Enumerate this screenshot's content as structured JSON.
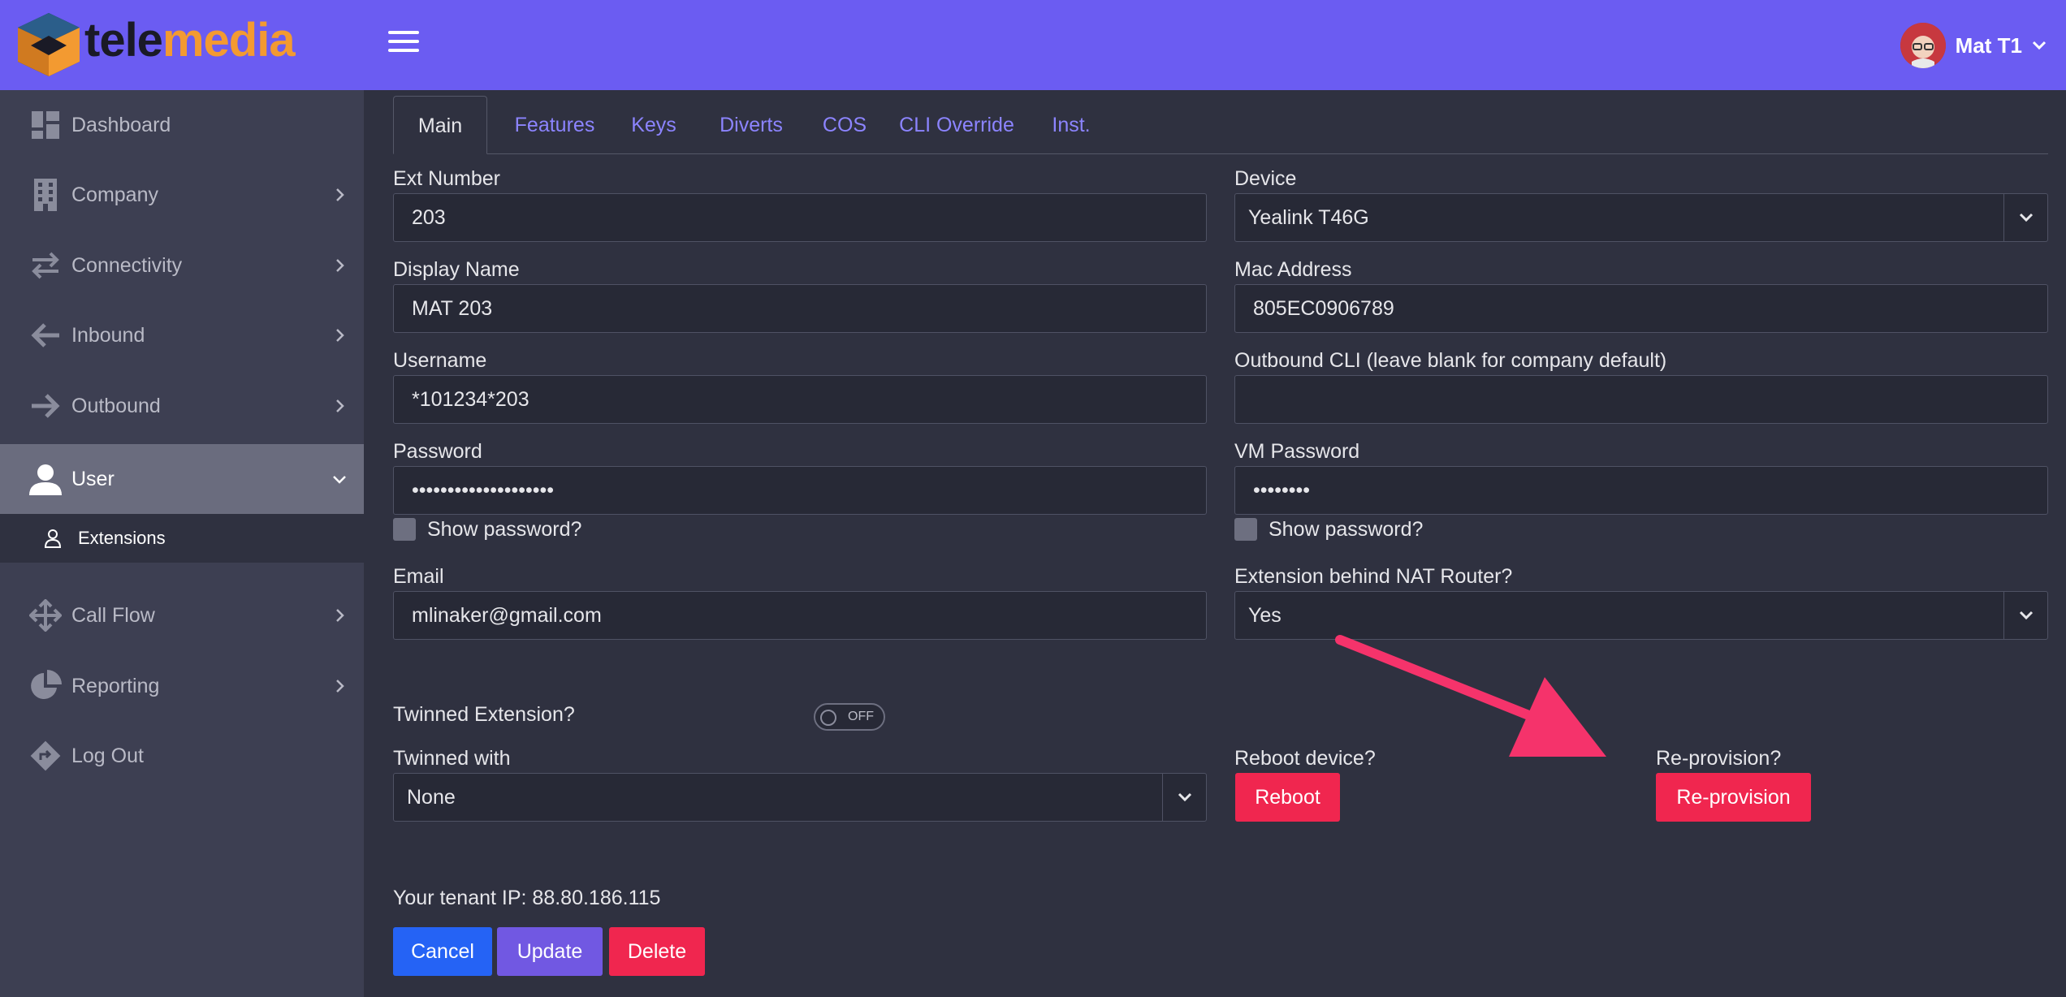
{
  "header": {
    "brand_part1": "tele",
    "brand_part2": "media",
    "user_name": "Mat T1"
  },
  "sidebar": {
    "items": [
      {
        "label": "Dashboard"
      },
      {
        "label": "Company"
      },
      {
        "label": "Connectivity"
      },
      {
        "label": "Inbound"
      },
      {
        "label": "Outbound"
      },
      {
        "label": "User"
      },
      {
        "label": "Call Flow"
      },
      {
        "label": "Reporting"
      },
      {
        "label": "Log Out"
      }
    ],
    "sub_item": "Extensions"
  },
  "tabs": [
    {
      "label": "Main"
    },
    {
      "label": "Features"
    },
    {
      "label": "Keys"
    },
    {
      "label": "Diverts"
    },
    {
      "label": "COS"
    },
    {
      "label": "CLI Override"
    },
    {
      "label": "Inst."
    }
  ],
  "form": {
    "ext_number_label": "Ext Number",
    "ext_number_value": "203",
    "display_name_label": "Display Name",
    "display_name_value": "MAT 203",
    "username_label": "Username",
    "username_value": "*101234*203",
    "password_label": "Password",
    "password_value": "••••••••••••••••••••",
    "show_password_label": "Show password?",
    "email_label": "Email",
    "email_value": "mlinaker@gmail.com",
    "device_label": "Device",
    "device_value": "Yealink T46G",
    "mac_label": "Mac Address",
    "mac_value": "805EC0906789",
    "outbound_cli_label": "Outbound CLI (leave blank for company default)",
    "outbound_cli_value": "",
    "vm_password_label": "VM Password",
    "vm_password_value": "••••••••",
    "vm_show_password_label": "Show password?",
    "nat_label": "Extension behind NAT Router?",
    "nat_value": "Yes",
    "twinned_label": "Twinned Extension?",
    "twinned_toggle": "OFF",
    "twinned_with_label": "Twinned with",
    "twinned_with_value": "None",
    "reboot_label": "Reboot device?",
    "reboot_button": "Reboot",
    "reprovision_label": "Re-provision?",
    "reprovision_button": "Re-provision"
  },
  "tenant_ip_text": "Your tenant IP: 88.80.186.115",
  "actions": {
    "cancel": "Cancel",
    "update": "Update",
    "delete": "Delete"
  },
  "colors": {
    "header": "#6b5cf2",
    "sidebar": "#3d3f52",
    "content": "#2f3140",
    "danger": "#f0264f",
    "primary": "#2563f5",
    "annotation_arrow": "#f5336b"
  }
}
